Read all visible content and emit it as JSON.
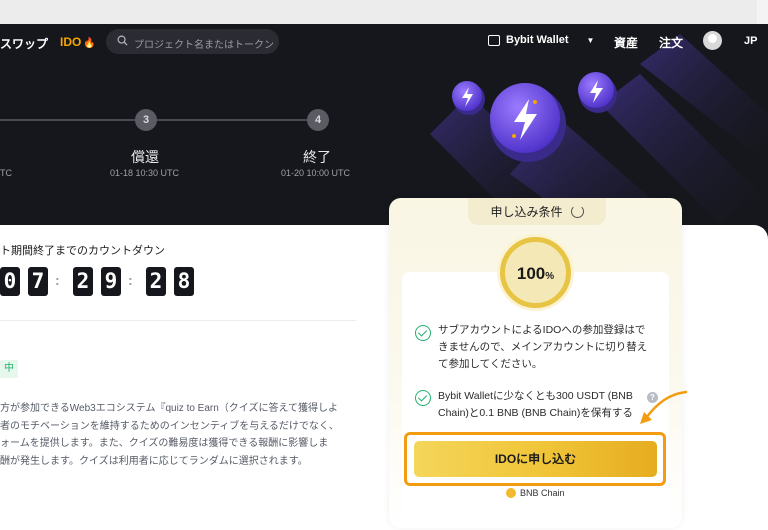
{
  "nav": {
    "swap": "スワップ",
    "ido": "IDO",
    "search_placeholder": "プロジェクト名またはトークンを",
    "wallet": "Bybit Wallet",
    "assets": "資産",
    "orders": "注文",
    "lang": "JP"
  },
  "steps": [
    {
      "number": "3",
      "title": "償還",
      "date": "01-18 10:30 UTC"
    },
    {
      "number": "4",
      "title": "終了",
      "date": "01-20 10:00 UTC"
    }
  ],
  "step_partial_date": "TC",
  "countdown": {
    "label": "ト期間終了までのカウントダウン",
    "digits": [
      "0",
      "7",
      "2",
      "9",
      "2",
      "8"
    ]
  },
  "status_badge": "中",
  "description": [
    "方が参加できるWeb3エコシステム『quiz to Earn（クイズに答えて獲得しよ",
    "者のモチベーションを維持するためのインセンティブを与えるだけでなく、",
    "ォームを提供します。また、クイズの難易度は獲得できる報酬に影響しま",
    "酬が発生します。クイズは利用者に応じてランダムに選択されます。"
  ],
  "conditions": {
    "tab_label": "申し込み条件",
    "percent": "100",
    "percent_sign": "%",
    "items": [
      {
        "lines": [
          "サブアカウントによるIDOへの参加登録はで",
          "きませんので、メインアカウントに切り替え",
          "て参加してください。"
        ]
      },
      {
        "lines": [
          "Bybit Walletに少なくとも300 USDT (BNB",
          "Chain)と0.1 BNB (BNB Chain)を保有する"
        ]
      }
    ],
    "cta": "IDOに申し込む",
    "chain": "BNB Chain"
  },
  "colors": {
    "accent": "#f7a600",
    "success": "#20b26c",
    "cta_outline": "#f39c12"
  }
}
